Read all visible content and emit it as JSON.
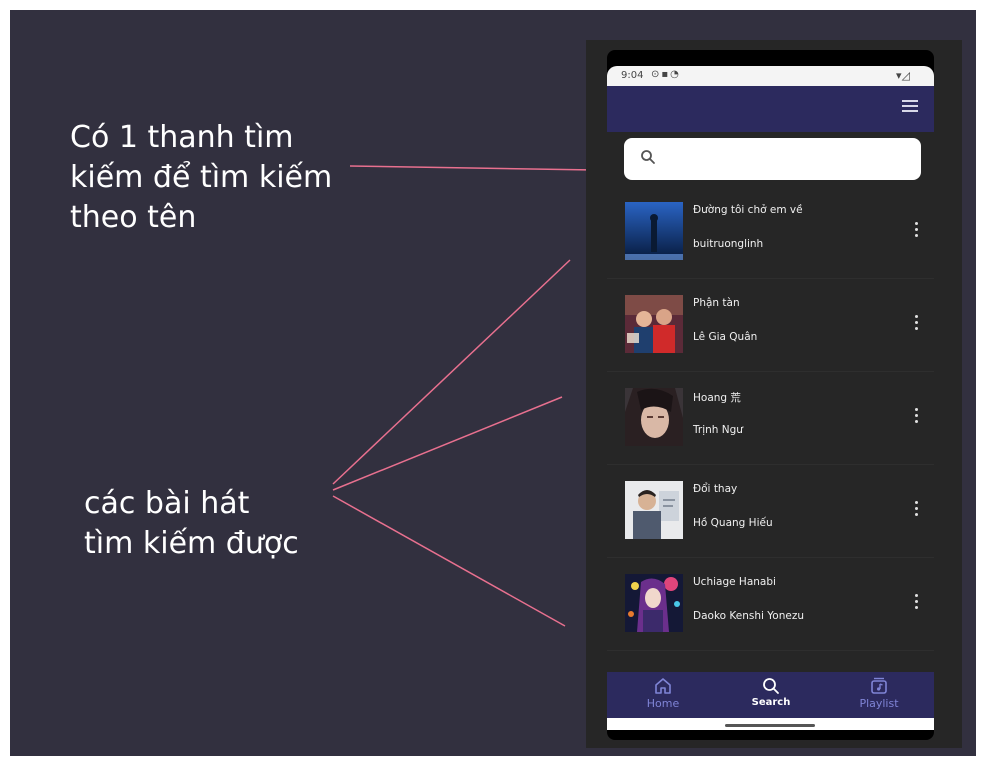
{
  "annotations": {
    "search_note": [
      "Có 1 thanh tìm",
      "kiếm để tìm kiếm",
      "theo tên"
    ],
    "songs_note": [
      "các bài hát",
      "tìm kiếm được"
    ],
    "line_color": "#e8708f"
  },
  "status_bar": {
    "time": "9:04"
  },
  "search": {
    "placeholder": "",
    "value": ""
  },
  "songs": [
    {
      "title": "Đường tôi chở em về",
      "artist": "buitruonglinh"
    },
    {
      "title": "Phận tàn",
      "artist": "Lê Gia Quân"
    },
    {
      "title": "Hoang 荒",
      "artist": "Trịnh Ngư"
    },
    {
      "title": "Đổi thay",
      "artist": "Hồ Quang Hiếu"
    },
    {
      "title": "Uchiage Hanabi",
      "artist": "Daoko Kenshi Yonezu"
    }
  ],
  "bottom_nav": {
    "home_label": "Home",
    "search_label": "Search",
    "playlist_label": "Playlist"
  },
  "colors": {
    "background": "#32303f",
    "app_bar": "#2c2a5e",
    "list_background": "#262626",
    "nav_label": "#7f84d6",
    "nav_active_label": "#ffffff"
  },
  "icons": [
    "menu-icon",
    "search-icon",
    "more-vert-icon",
    "home-icon",
    "playlist-icon"
  ]
}
